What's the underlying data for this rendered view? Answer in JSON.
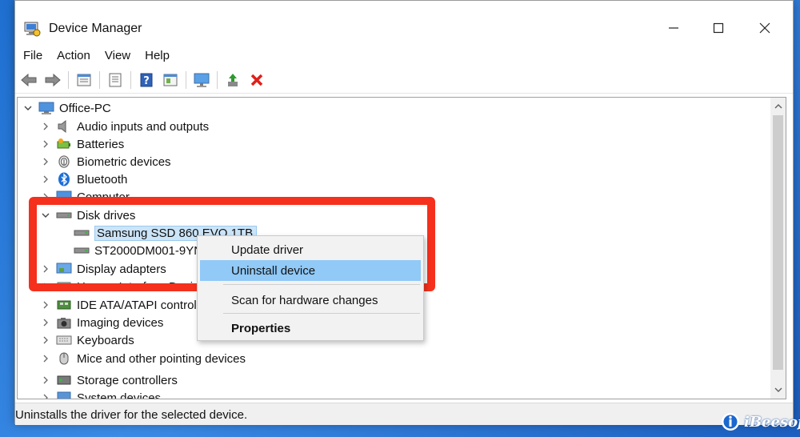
{
  "window": {
    "title": "Device Manager"
  },
  "menu": [
    "File",
    "Action",
    "View",
    "Help"
  ],
  "toolbar": [
    "back-icon",
    "forward-icon",
    "properties-icon",
    "list-icon",
    "help-icon",
    "panel-icon",
    "monitor-icon",
    "update-driver-icon",
    "uninstall-icon"
  ],
  "tree": {
    "root": "Office-PC",
    "items": {
      "audio": "Audio inputs and outputs",
      "batteries": "Batteries",
      "biometric": "Biometric devices",
      "bluetooth": "Bluetooth",
      "computer": "Computer",
      "disk": "Disk drives",
      "disk_child_1": "Samsung SSD 860 EVO 1TB",
      "disk_child_2": "ST2000DM001-9YN1",
      "display": "Display adapters",
      "hid": "Human Interface Devices",
      "ide": "IDE ATA/ATAPI controllers",
      "imaging": "Imaging devices",
      "keyboards": "Keyboards",
      "mice": "Mice and other pointing devices",
      "storage": "Storage controllers",
      "system": "System devices"
    }
  },
  "context_menu": {
    "update": "Update driver",
    "uninstall": "Uninstall device",
    "scan": "Scan for hardware changes",
    "properties": "Properties"
  },
  "status": "Uninstalls the driver for the selected device.",
  "brand": "iBeesoft",
  "colors": {
    "highlight_box": "#f5301c",
    "menu_hover": "#91c9f7",
    "selection": "#cce4f7"
  }
}
